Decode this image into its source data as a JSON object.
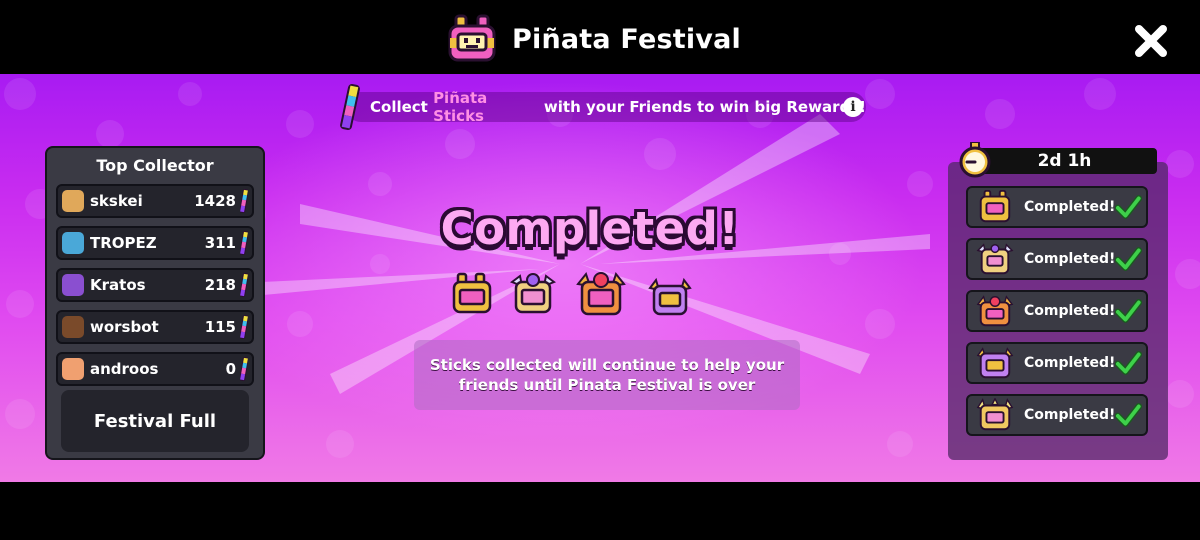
{
  "header": {
    "title": "Piñata Festival"
  },
  "banner": {
    "text_before": "Collect ",
    "highlight": "Piñata Sticks",
    "text_after": " with your Friends to win big Rewards!",
    "info_icon": "i"
  },
  "leaderboard": {
    "title": "Top Collector",
    "players": [
      {
        "name": "skskei",
        "count": "1428",
        "avatar_color": "#e0a85a"
      },
      {
        "name": "TROPEZ",
        "count": "311",
        "avatar_color": "#4aa8d8"
      },
      {
        "name": "Kratos",
        "count": "218",
        "avatar_color": "#8a4fd0"
      },
      {
        "name": "worsbot",
        "count": "115",
        "avatar_color": "#7a4a2a"
      },
      {
        "name": "androos",
        "count": "0",
        "avatar_color": "#f0a070"
      }
    ],
    "button_label": "Festival Full"
  },
  "status": {
    "headline": "Completed!",
    "info_line1": "Sticks collected will continue to help your",
    "info_line2": "friends until Pinata Festival is over"
  },
  "timer": {
    "remaining": "2d 1h"
  },
  "tiers": [
    {
      "label": "Completed!",
      "color": "#f0c040"
    },
    {
      "label": "Completed!",
      "color": "#f0d080"
    },
    {
      "label": "Completed!",
      "color": "#f09040"
    },
    {
      "label": "Completed!",
      "color": "#c080f0"
    },
    {
      "label": "Completed!",
      "color": "#f0c860"
    }
  ],
  "colors": {
    "accent_pink": "#ff8fe5",
    "check_green": "#3ed14a",
    "panel": "#3a3a44"
  }
}
